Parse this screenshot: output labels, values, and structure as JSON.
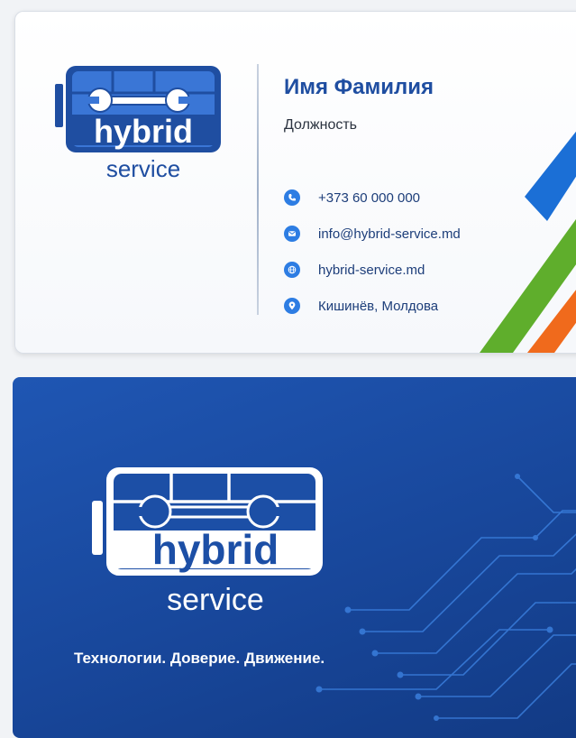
{
  "front": {
    "logo": {
      "word_top": "hybrid",
      "word_bottom": "service"
    },
    "name": "Имя Фамилия",
    "position": "Должность",
    "contacts": [
      {
        "icon": "phone-icon",
        "text": "+373 60 000 000"
      },
      {
        "icon": "email-icon",
        "text": "info@hybrid-service.md"
      },
      {
        "icon": "globe-icon",
        "text": "hybrid-service.md"
      },
      {
        "icon": "location-pin-icon",
        "text": "Кишинёв, Молдова"
      }
    ],
    "stripe_colors": [
      "#1b6fd6",
      "#5fae2c",
      "#f06a1c"
    ]
  },
  "back": {
    "logo": {
      "word_top": "hybrid",
      "word_bottom": "service"
    },
    "slogan": "Технологии. Доверие. Движение."
  },
  "colors": {
    "brand_blue": "#1f4ea1",
    "back_bg": "#1a4ba3",
    "icon_blue": "#2d7de3"
  }
}
